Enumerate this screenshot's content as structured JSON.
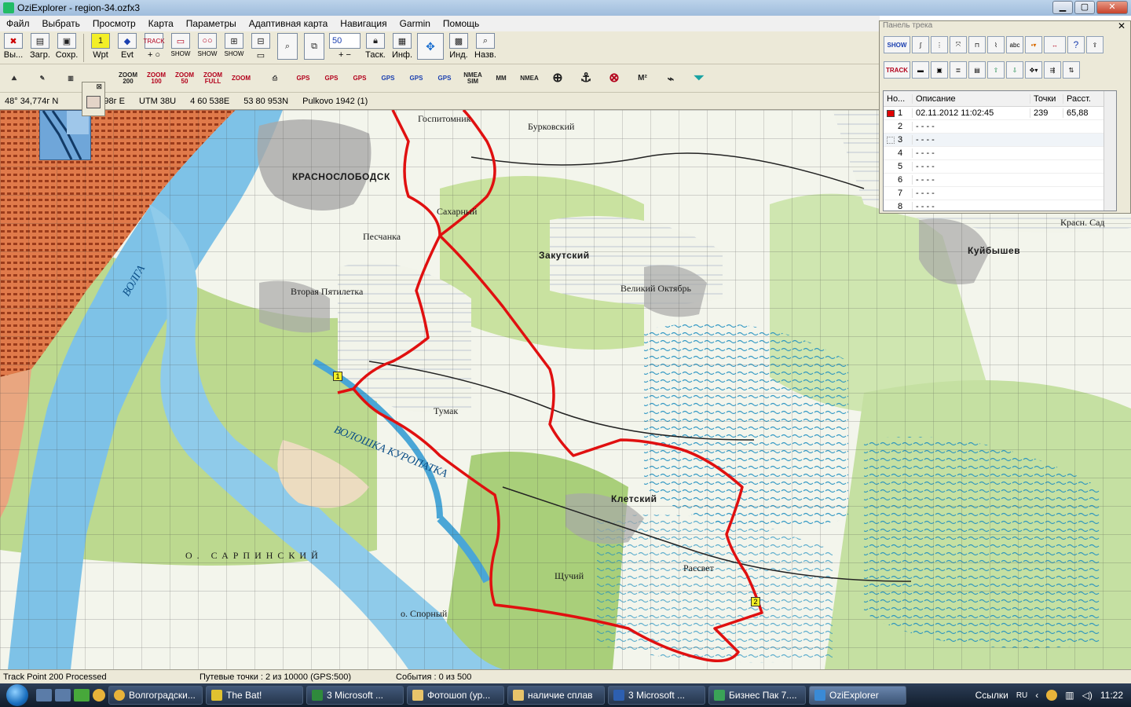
{
  "window": {
    "title": "OziExplorer - region-34.ozfx3",
    "min": "▁",
    "max": "▢",
    "close": "✕"
  },
  "menu": [
    "Файл",
    "Выбрать",
    "Просмотр",
    "Карта",
    "Параметры",
    "Адаптивная карта",
    "Навигация",
    "Garmin",
    "Помощь"
  ],
  "toolbar1": {
    "buttons": [
      {
        "name": "exit",
        "label": "Вы...",
        "icon": "exit-icon"
      },
      {
        "name": "load",
        "label": "Загр.",
        "icon": "load-icon"
      },
      {
        "name": "save",
        "label": "Сохр.",
        "icon": "save-icon"
      },
      {
        "name": "wpt",
        "label": "Wpt",
        "icon": "waypoint-icon"
      },
      {
        "name": "evt",
        "label": "Evt",
        "icon": "event-icon"
      },
      {
        "name": "show",
        "label": "SHOW",
        "icon": "show-icon"
      },
      {
        "name": "show2",
        "label": "SHOW",
        "icon": "show2-icon"
      },
      {
        "name": "show3",
        "label": "SHOW",
        "icon": "show3-icon"
      },
      {
        "name": "tasks",
        "label": "Таск.",
        "icon": "lock-icon"
      },
      {
        "name": "info",
        "label": "Инф.",
        "icon": "info-icon"
      },
      {
        "name": "ind",
        "label": "Инд.",
        "icon": "index-icon"
      },
      {
        "name": "names",
        "label": "Назв.",
        "icon": "names-icon"
      }
    ],
    "zoom_value": "50",
    "track_label": "TRACK"
  },
  "toolbar2": [
    "ZOOM\n200",
    "ZOOM\n100",
    "ZOOM\n50",
    "ZOOM\nFULL",
    "ZOOM",
    "GPS",
    "GPS",
    "GPS",
    "GPS",
    "GPS",
    "GPS",
    "NMEA SIM",
    "MM",
    "NMEA"
  ],
  "coords": {
    "lat": "48° 34,774г N",
    "lon": "98г E",
    "utm": "UTM  38U",
    "east": "4 60 538E",
    "north": "53 80 953N",
    "datum": "Pulkovo 1942 (1)"
  },
  "track_panel": {
    "title": "Панель трека",
    "show_label": "SHOW",
    "track_label": "TRACK",
    "columns": [
      "Но...",
      "Описание",
      "Точки",
      "Расст."
    ],
    "rows": [
      {
        "num": "1",
        "desc": "02.11.2012 11:02:45",
        "points": "239",
        "dist": "65,88",
        "color": "#e00000"
      },
      {
        "num": "2",
        "desc": "- - - -",
        "points": "",
        "dist": "",
        "color": ""
      },
      {
        "num": "3",
        "desc": "- - - -",
        "points": "",
        "dist": "",
        "color": ""
      },
      {
        "num": "4",
        "desc": "- - - -",
        "points": "",
        "dist": "",
        "color": ""
      },
      {
        "num": "5",
        "desc": "- - - -",
        "points": "",
        "dist": "",
        "color": ""
      },
      {
        "num": "6",
        "desc": "- - - -",
        "points": "",
        "dist": "",
        "color": ""
      },
      {
        "num": "7",
        "desc": "- - - -",
        "points": "",
        "dist": "",
        "color": ""
      },
      {
        "num": "8",
        "desc": "- - - -",
        "points": "",
        "dist": "",
        "color": ""
      }
    ]
  },
  "map": {
    "labels": {
      "krasnoslobodsk": "КРАСНОСЛОБОДСК",
      "zakutsky": "Закутский",
      "kletsky": "Клетский",
      "sakharny": "Сахарный",
      "pesschanka": "Песчанка",
      "vtoraya": "Вторая Пятилетка",
      "tumak": "Тумак",
      "burkovsky": "Бурковский",
      "velikiy": "Великий Октябрь",
      "kuibyshev": "Куйбышев",
      "volga": "ВОЛГА",
      "voloshka": "ВОЛОШКА КУРОПАТКА",
      "osarp": "О. САРПИНСКИЙ",
      "rassvet": "Рассвет",
      "krasn_sad": "Красн. Сад",
      "shuchiy": "Щучий",
      "sporny": "о. Спорный",
      "gospitom": "Госпитомник"
    },
    "waypoints": [
      "1",
      "2"
    ],
    "track_color": "#e01010"
  },
  "status": {
    "left": "Track Point 200 Processed",
    "mid": "Путевые точки : 2 из 10000  (GPS:500)",
    "right": "События : 0 из 500"
  },
  "taskbar": {
    "tasks": [
      "Волгоградски...",
      "The Bat!",
      "3 Microsoft ...",
      "Фотошоп (ур...",
      "наличие сплав",
      "3 Microsoft ...",
      "Бизнес Пак 7....",
      "OziExplorer"
    ],
    "links": "Ссылки",
    "lang": "RU",
    "time": "11:22"
  }
}
